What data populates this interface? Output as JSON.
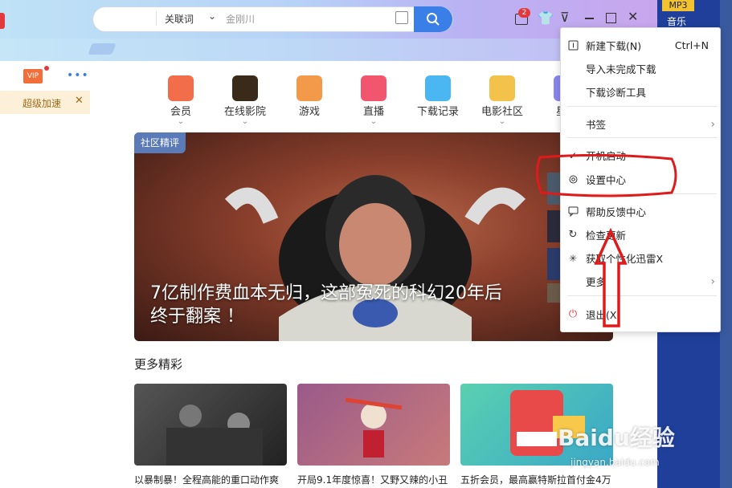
{
  "search": {
    "tag": "关联词",
    "placeholder": "金刚川"
  },
  "titlebar": {
    "badge_count": "2"
  },
  "left_panel": {
    "vip_label": "VIP",
    "promo_label": "超级加速"
  },
  "categories": [
    {
      "label": "会员",
      "color": "#f26e4a"
    },
    {
      "label": "在线影院",
      "color": "#3a2a1a"
    },
    {
      "label": "游戏",
      "color": "#f29a4a"
    },
    {
      "label": "直播",
      "color": "#f2566e"
    },
    {
      "label": "下载记录",
      "color": "#4ab6f2"
    },
    {
      "label": "电影社区",
      "color": "#f2c24a"
    },
    {
      "label": "星际",
      "color": "#8a86f2"
    }
  ],
  "hero": {
    "tag": "社区精评",
    "title_line1": "7亿制作费血本无归，这部冤死的科幻20年后",
    "title_line2": "终于翻案 ！"
  },
  "more": {
    "section_title": "更多精彩"
  },
  "cards": [
    {
      "caption": "以暴制暴！全程高能的重口动作爽"
    },
    {
      "caption": "开局9.1年度惊喜！又野又辣的小丑"
    },
    {
      "caption": "五折会员，最高赢特斯拉首付金4万"
    }
  ],
  "desktop": {
    "mp3_label": "MP3",
    "music_label": "音乐"
  },
  "watermark": {
    "text": "Baidu经验",
    "subtext": "jingyan.baidu.com"
  },
  "menu": {
    "items": [
      {
        "label": "新建下载(N)",
        "shortcut": "Ctrl+N",
        "icon": "new-download-icon"
      },
      {
        "label": "导入未完成下载"
      },
      {
        "label": "下载诊断工具"
      },
      {
        "label": "书签",
        "submenu": true
      },
      {
        "label": "开机启动",
        "checked": true
      },
      {
        "label": "设置中心",
        "icon": "gear-icon"
      },
      {
        "label": "帮助反馈中心",
        "icon": "feedback-icon"
      },
      {
        "label": "检查更新",
        "icon": "refresh-icon"
      },
      {
        "label": "获取个性化迅雷X",
        "icon": "sparkle-icon"
      },
      {
        "label": "更多",
        "submenu": true
      },
      {
        "label": "退出(X)",
        "icon": "power-icon"
      }
    ]
  }
}
